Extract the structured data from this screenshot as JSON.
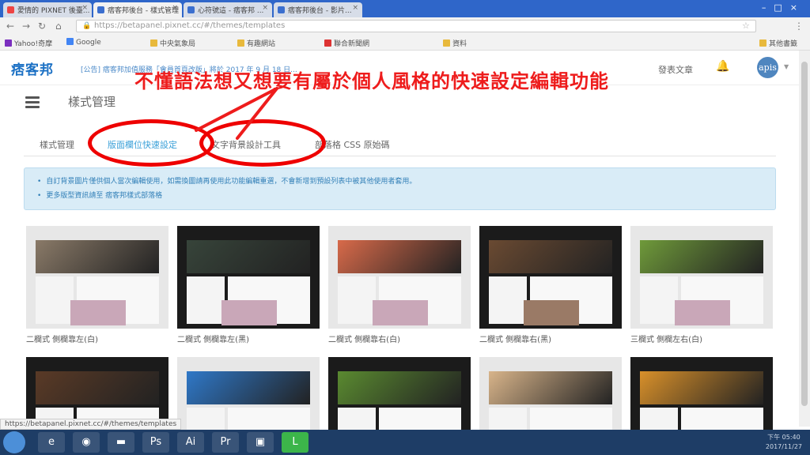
{
  "browser": {
    "tabs": [
      {
        "label": "愛情的 PIXNET 後臺..."
      },
      {
        "label": "痞客邦後台 - 樣式管理"
      },
      {
        "label": "心符號這 - 痞客邦 ..."
      },
      {
        "label": "痞客邦後台 - 影片..."
      }
    ],
    "address": "https://betapanel.pixnet.cc/#/themes/templates",
    "bookmarks": [
      "Yahoo!奇摩",
      "Google",
      "中央氣象局",
      "有趣網站",
      "聯合新聞網",
      "資料",
      "其他書籤"
    ]
  },
  "header": {
    "logo": "痞客邦",
    "announcement": "[公告] 痞客邦加值服務「會員首頁改版」將於 2017 年 9 月 18 日...",
    "post_link": "發表文章",
    "avatar_text": "apis"
  },
  "page": {
    "title": "樣式管理",
    "tabs": [
      {
        "label": "樣式管理",
        "active": false
      },
      {
        "label": "版面欄位快速設定",
        "active": true
      },
      {
        "label": "文字背景設計工具",
        "active": false
      },
      {
        "label": "部落格 CSS 原始碼",
        "active": false
      }
    ],
    "notice": [
      "自訂背景圖片僅供個人當次編輯使用，如需換圖請再使用此功能編輯重選，不會新增到預設列表中被其他使用者套用。",
      "更多版型資訊請至 痞客邦樣式部落格"
    ],
    "templates": [
      {
        "caption": "二欄式 側欄靠左(白)",
        "banner": "#8a7a68",
        "photo": "#c9a7b8"
      },
      {
        "caption": "二欄式 側欄靠左(黑)",
        "banner": "#37443a",
        "photo": "#c9a7b8"
      },
      {
        "caption": "二欄式 側欄靠右(白)",
        "banner": "#d86a4a",
        "photo": "#c9a7b8"
      },
      {
        "caption": "二欄式 側欄靠右(黑)",
        "banner": "#6a4a32",
        "photo": "#9a7a66"
      },
      {
        "caption": "三欄式 側欄左右(白)",
        "banner": "#6f9a3a",
        "photo": "#c9a7b8"
      },
      {
        "caption": "",
        "banner": "#5a3a26",
        "photo": "#7a6656"
      },
      {
        "caption": "",
        "banner": "#2f78c8",
        "photo": "#2f78c8"
      },
      {
        "caption": "",
        "banner": "#5a8a30",
        "photo": "#3a6a28"
      },
      {
        "caption": "",
        "banner": "#d8b48a",
        "photo": "#c99a6a"
      },
      {
        "caption": "",
        "banner": "#d8902a",
        "photo": "#8a6a3a"
      }
    ]
  },
  "annotation": {
    "text": "不懂語法想又想要有屬於個人風格的快速設定編輯功能",
    "color": "#ee1c1c"
  },
  "statusbar": {
    "text": "https://betapanel.pixnet.cc/#/themes/templates"
  },
  "taskbar": {
    "icons": [
      "ie-icon",
      "chrome-icon",
      "folder-icon",
      "photoshop-icon",
      "illustrator-icon",
      "premiere-icon",
      "window-icon",
      "line-icon"
    ],
    "clock": [
      "下午 05:40",
      "2017/11/27"
    ]
  }
}
